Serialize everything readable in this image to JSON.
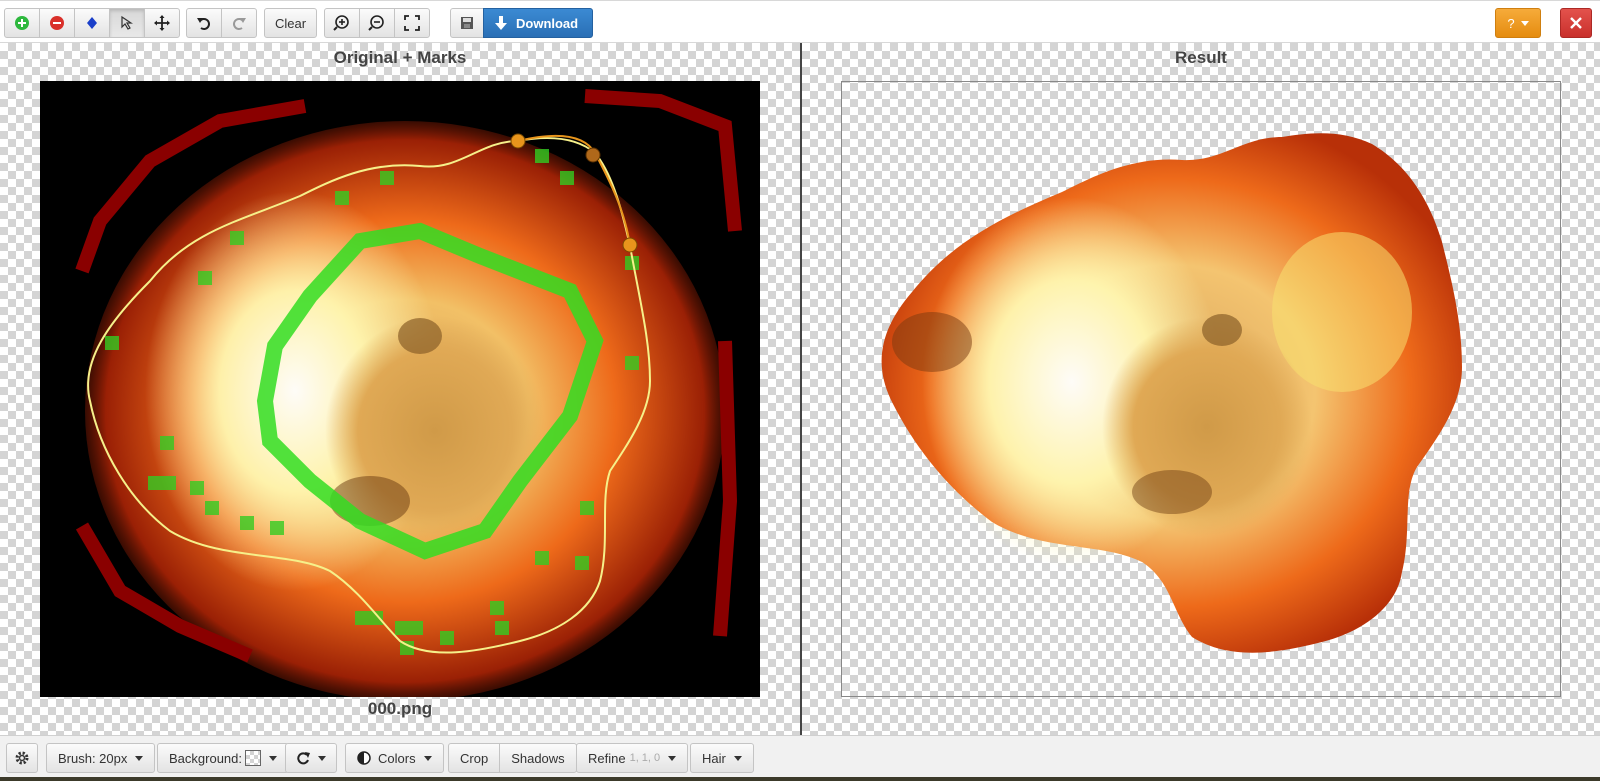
{
  "toolbar": {
    "clear_label": "Clear",
    "download_label": "Download",
    "help_label": "?",
    "accent": "#2a6fb5"
  },
  "panels": {
    "left_title": "Original + Marks",
    "right_title": "Result",
    "filename": "000.png"
  },
  "bottom": {
    "brush_label": "Brush: 20px",
    "background_label": "Background:",
    "colors_label": "Colors",
    "crop_label": "Crop",
    "shadows_label": "Shadows",
    "refine_label": "Refine",
    "refine_values": "1, 1, 0",
    "hair_label": "Hair"
  },
  "icons": [
    "add-icon",
    "remove-icon",
    "diamond-icon",
    "pointer-icon",
    "move-icon",
    "undo-icon",
    "redo-icon",
    "zoom-in-icon",
    "zoom-out-icon",
    "fullscreen-icon",
    "save-icon",
    "download-icon",
    "close-icon",
    "gear-icon",
    "rotate-icon",
    "contrast-icon"
  ],
  "colors": {
    "mark_green": "#33dd22",
    "mark_red": "#8a0000",
    "outline_yellow": "#f6f08a",
    "handle_orange": "#e8951c"
  }
}
